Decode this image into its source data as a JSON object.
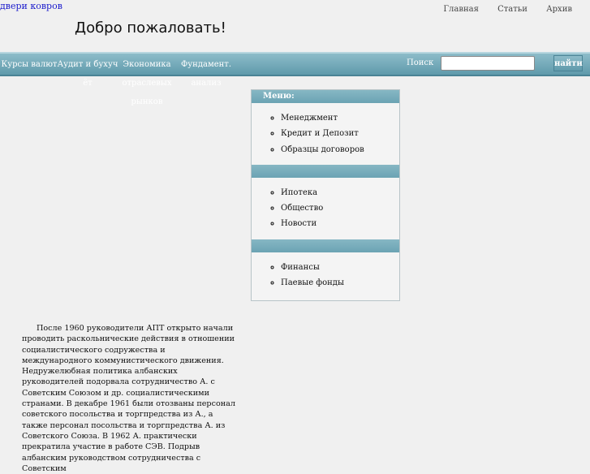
{
  "header": {
    "logo_link": "двери ковров",
    "top_links": [
      "Главная",
      "Статьи",
      "Архив"
    ],
    "welcome": "Добро пожаловать!"
  },
  "nav": {
    "items": [
      {
        "label": "Курсы валют",
        "faded": false
      },
      {
        "label": "Аудит и бухучёт",
        "faded": false
      },
      {
        "label": "Экономика отраслевых рынков",
        "faded": false
      },
      {
        "label": "Фундамент. анализ",
        "faded": false
      }
    ]
  },
  "search": {
    "label": "Поиск",
    "value": "",
    "button": "найти"
  },
  "menu": {
    "title": "Меню:",
    "groups": [
      [
        "Менеджмент",
        "Кредит и Депозит",
        "Образцы договоров"
      ],
      [
        "Ипотека",
        "Общество",
        "Новости"
      ],
      [
        "Финансы",
        "Паевые фонды"
      ]
    ]
  },
  "article": {
    "text": "После 1960 руководители АПТ открыто начали проводить раскольнические действия в отношении социалистического содружества и международного коммунистического движения. Недружелюбная политика албанских руководителей подорвала сотрудничество А. с Советским Союзом и др. социалистическими странами. В декабре 1961 были отозваны персонал советского посольства и торгпредства из А., а также персонал посольства и торгпредства А. из Советского Союза. В 1962 А. практически прекратила участие в работе СЭВ. Подрыв албанским руководством сотрудничества с Советским"
  }
}
